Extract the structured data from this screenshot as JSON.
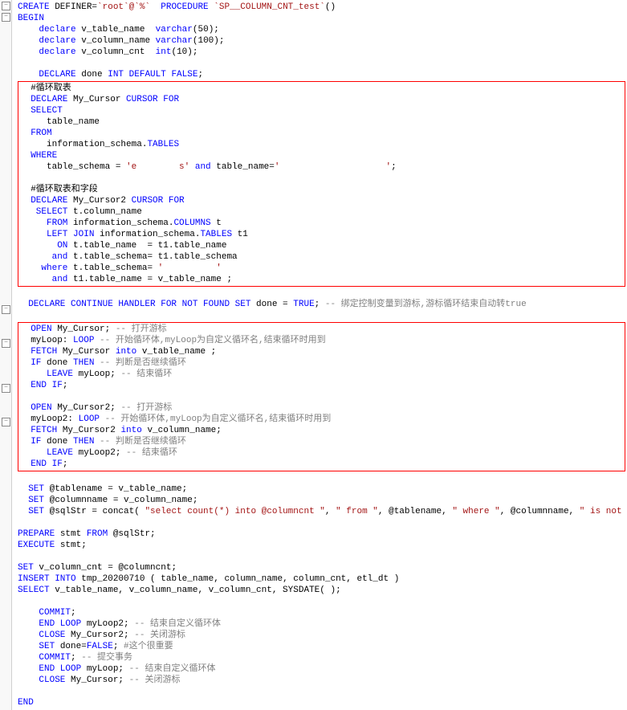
{
  "code": {
    "l1a": "CREATE",
    "l1b": " DEFINER=",
    "l1c": "`root`@`%`",
    "l1d": "  PROCEDURE ",
    "l1e": "`SP_",
    "l1f": "_COLUMN_CNT_test`",
    "l1g": "()",
    "l2": "BEGIN",
    "l3a": "    declare",
    "l3b": " v_table_name  ",
    "l3c": "varchar",
    "l3d": "(",
    "l3e": "50",
    "l3f": ");",
    "l4a": "    declare",
    "l4b": " v_column_name ",
    "l4c": "varchar",
    "l4d": "(",
    "l4e": "100",
    "l4f": ");",
    "l5a": "    declare",
    "l5b": " v_column_cnt  ",
    "l5c": "int",
    "l5d": "(",
    "l5e": "10",
    "l5f": ");",
    "l7a": "    DECLARE",
    "l7b": " done ",
    "l7c": "INT DEFAULT FALSE",
    "l7d": ";",
    "l8": "  #循环取表",
    "l9a": "  DECLARE",
    "l9b": " My_Cursor ",
    "l9c": "CURSOR FOR",
    "l10": "  SELECT",
    "l11": "     table_name",
    "l12": "  FROM",
    "l13a": "     information_schema.",
    "l13b": "TABLES",
    "l14": "  WHERE",
    "l15a": "     table_schema = ",
    "l15b": "'e",
    "l15c": "s'",
    "l15d": " and",
    "l15e": " table_name=",
    "l15f": "'",
    "l15g": "'",
    "l15h": ";",
    "l17": "  #循环取表和字段",
    "l18a": "  DECLARE",
    "l18b": " My_Cursor2 ",
    "l18c": "CURSOR FOR",
    "l19a": "   SELECT",
    "l19b": " t.column_name",
    "l20a": "     FROM",
    "l20b": " information_schema.",
    "l20c": "COLUMNS",
    "l20d": " t",
    "l21a": "     LEFT JOIN",
    "l21b": " information_schema.",
    "l21c": "TABLES",
    "l21d": " t1",
    "l22a": "       ON",
    "l22b": " t.table_name  = t1.table_name",
    "l23a": "      and",
    "l23b": " t.table_schema= t1.table_schema",
    "l24a": "    where",
    "l24b": " t.table_schema= ",
    "l24c": "'",
    "l24d": "'",
    "l25a": "      and",
    "l25b": " t1.table_name = v_table_name ;",
    "l27a": "  DECLARE CONTINUE HANDLER FOR NOT FOUND SET",
    "l27b": " done = ",
    "l27c": "TRUE",
    "l27d": "; ",
    "l27e": "-- 绑定控制变量到游标,游标循环结束自动转",
    "l27f": "true",
    "l29a": "  OPEN",
    "l29b": " My_Cursor; ",
    "l29c": "-- 打开游标",
    "l30a": "  myLoop: ",
    "l30b": "LOOP",
    "l30c": " -- 开始循环体,",
    "l30d": "myLoop",
    "l30e": "为自定义循环名,结束循环时用到",
    "l31a": "  FETCH",
    "l31b": " My_Cursor ",
    "l31c": "into",
    "l31d": " v_table_name ;",
    "l32a": "  IF",
    "l32b": " done ",
    "l32c": "THEN",
    "l32d": " -- 判断是否继续循环",
    "l33a": "     LEAVE",
    "l33b": " myLoop; ",
    "l33c": "-- 结束循环",
    "l34a": "  END",
    "l34b": " IF",
    "l34c": ";",
    "l36a": "  OPEN",
    "l36b": " My_Cursor2; ",
    "l36c": "-- 打开游标",
    "l37a": "  myLoop2: ",
    "l37b": "LOOP",
    "l37c": " -- 开始循环体,",
    "l37d": "myLoop",
    "l37e": "为自定义循环名,结束循环时用到",
    "l38a": "  FETCH",
    "l38b": " My_Cursor2 ",
    "l38c": "into",
    "l38d": " v_column_name;",
    "l39a": "  IF",
    "l39b": " done ",
    "l39c": "THEN",
    "l39d": " -- 判断是否继续循环",
    "l40a": "     LEAVE",
    "l40b": " myLoop2; ",
    "l40c": "-- 结束循环",
    "l41a": "  END",
    "l41b": " IF",
    "l41c": ";",
    "l43a": "  SET",
    "l43b": " @tablename = v_table_name;",
    "l44a": "  SET",
    "l44b": " @columnname = v_column_name;",
    "l45a": "  SET",
    "l45b": " @sqlStr = concat( ",
    "l45c": "\"select count(*) into @columncnt \"",
    "l45d": ", ",
    "l45e": "\" from \"",
    "l45f": ", @tablename, ",
    "l45g": "\" where \"",
    "l45h": ", @columnname, ",
    "l45i": "\" is not null ; \"",
    "l45j": " );",
    "l47a": "PREPARE",
    "l47b": " stmt ",
    "l47c": "FROM",
    "l47d": " @sqlStr;",
    "l48a": "EXECUTE",
    "l48b": " stmt;",
    "l50a": "SET",
    "l50b": " v_column_cnt = @columncnt;",
    "l51a": "INSERT INTO",
    "l51b": " tmp_20200710 ( table_name, column_name, column_cnt, etl_dt )",
    "l52a": "SELECT",
    "l52b": " v_table_name, v_column_name, v_column_cnt, SYSDATE( );",
    "l54a": "    COMMIT",
    "l54b": ";",
    "l55a": "    END LOOP",
    "l55b": " myLoop2; ",
    "l55c": "-- 结束自定义循环体",
    "l56a": "    CLOSE",
    "l56b": " My_Cursor2; ",
    "l56c": "-- 关闭游标",
    "l57a": "    SET",
    "l57b": " done=",
    "l57c": "FALSE",
    "l57d": "; ",
    "l57e": "#这个很重要",
    "l58a": "    COMMIT",
    "l58b": "; ",
    "l58c": "-- 提交事务",
    "l59a": "    END LOOP",
    "l59b": " myLoop; ",
    "l59c": "-- 结束自定义循环体",
    "l60a": "    CLOSE",
    "l60b": " My_Cursor; ",
    "l60c": "-- 关闭游标",
    "l62": "END"
  }
}
